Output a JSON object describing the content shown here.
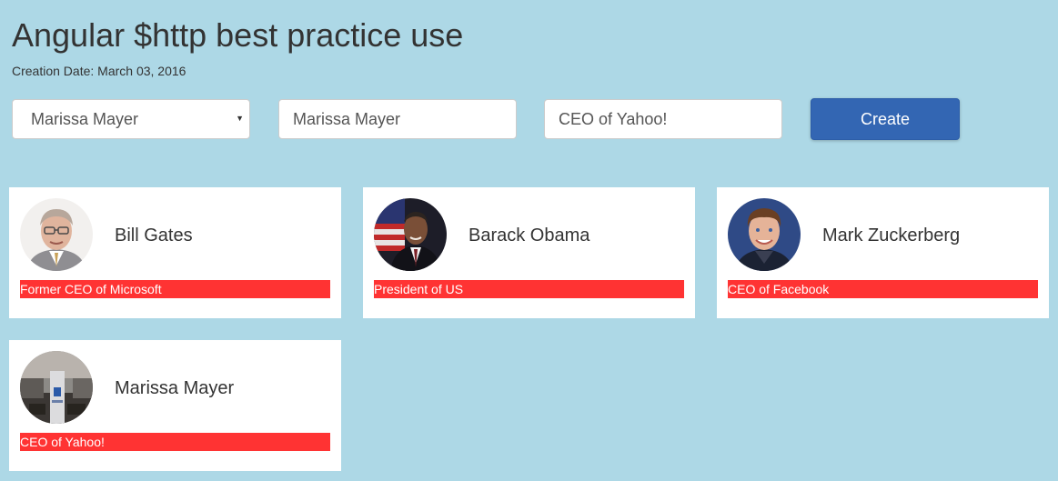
{
  "header": {
    "title": "Angular $http best practice use",
    "creation_date": "Creation Date: March 03, 2016"
  },
  "form": {
    "select": {
      "selected": "Marissa Mayer",
      "arrow_icon": "caret-down-icon"
    },
    "name_input": {
      "value": "Marissa Mayer"
    },
    "title_input": {
      "value": "CEO of Yahoo!"
    },
    "create_label": "Create"
  },
  "people": [
    {
      "name": "Bill Gates",
      "title": "Former CEO of Microsoft"
    },
    {
      "name": "Barack Obama",
      "title": "President of US"
    },
    {
      "name": "Mark Zuckerberg",
      "title": "CEO of Facebook"
    },
    {
      "name": "Marissa Mayer",
      "title": "CEO of Yahoo!"
    }
  ],
  "colors": {
    "background": "#add8e6",
    "button": "#3366b3",
    "title_bar": "#ff3333"
  }
}
